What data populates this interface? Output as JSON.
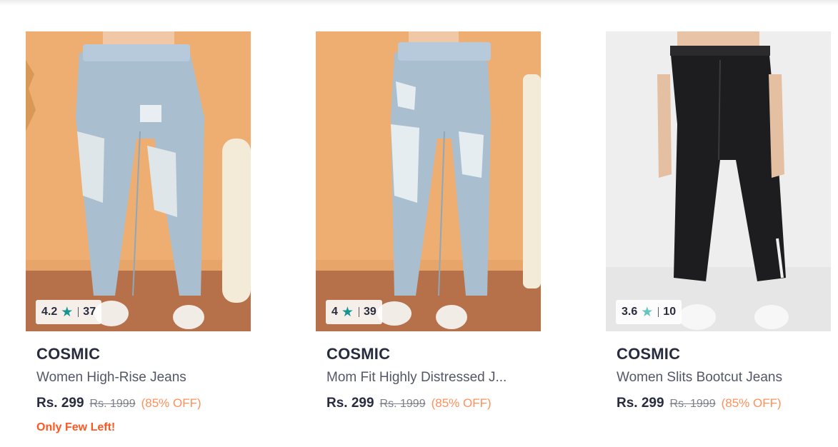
{
  "theme": {
    "rating_star_color": "#14958f",
    "discount_color": "#ff905a",
    "scarcity_color": "#ff5722"
  },
  "products": [
    {
      "brand": "COSMIC",
      "name": "Women High-Rise Jeans",
      "price": "Rs. 299",
      "mrp": "Rs. 1999",
      "discount": "(85% OFF)",
      "rating": "4.2",
      "rating_count": "37",
      "star_icon": "star-icon",
      "scarcity": "Only Few Left!"
    },
    {
      "brand": "COSMIC",
      "name": "Mom Fit Highly Distressed J...",
      "price": "Rs. 299",
      "mrp": "Rs. 1999",
      "discount": "(85% OFF)",
      "rating": "4",
      "rating_count": "39",
      "star_icon": "star-icon"
    },
    {
      "brand": "COSMIC",
      "name": "Women Slits Bootcut Jeans",
      "price": "Rs. 299",
      "mrp": "Rs. 1999",
      "discount": "(85% OFF)",
      "rating": "3.6",
      "rating_count": "10",
      "star_icon": "star-icon"
    }
  ]
}
